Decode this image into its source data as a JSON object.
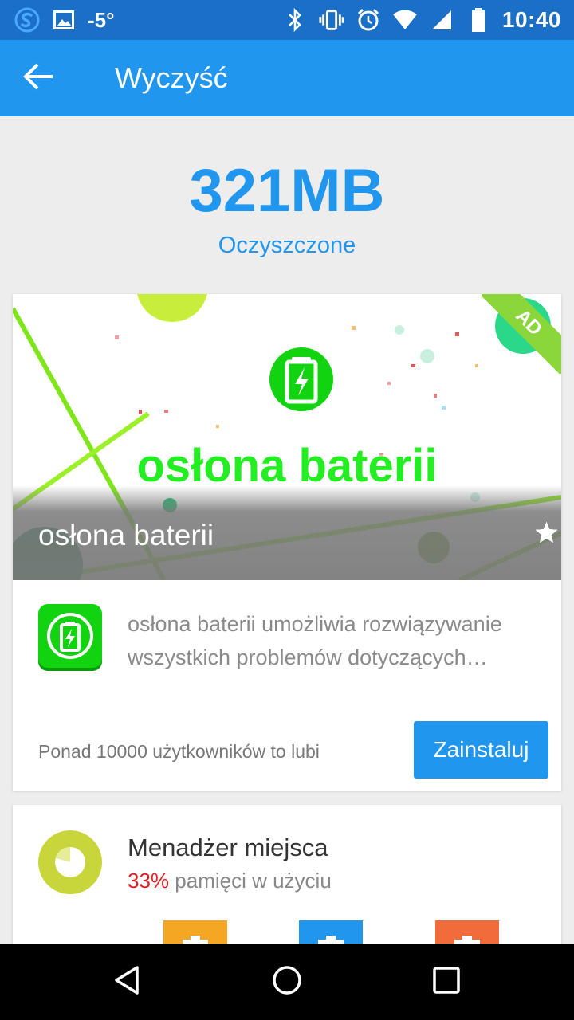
{
  "status_bar": {
    "temperature": "-5°",
    "time": "10:40"
  },
  "app_bar": {
    "title": "Wyczyść"
  },
  "summary": {
    "cleaned_size": "321MB",
    "cleaned_label": "Oczyszczone"
  },
  "ad": {
    "badge": "AD",
    "banner_headline": "osłona baterii",
    "app_name": "osłona baterii",
    "rating_stars": 5,
    "description": "osłona baterii umożliwia rozwiązywanie wszystkich problemów dotyczących…",
    "users_text": "Ponad 10000 użytkowników to lubi",
    "install_label": "Zainstaluj"
  },
  "storage": {
    "title": "Menadżer miejsca",
    "percent": "33%",
    "subtitle": " pamięci w użyciu",
    "tile_colors": [
      "#f5a623",
      "#2196ee",
      "#f26b3a"
    ]
  },
  "colors": {
    "accent": "#2196ee",
    "status_bar": "#1a6fc6",
    "usage_red": "#e02020",
    "battery_green": "#11d30f"
  }
}
